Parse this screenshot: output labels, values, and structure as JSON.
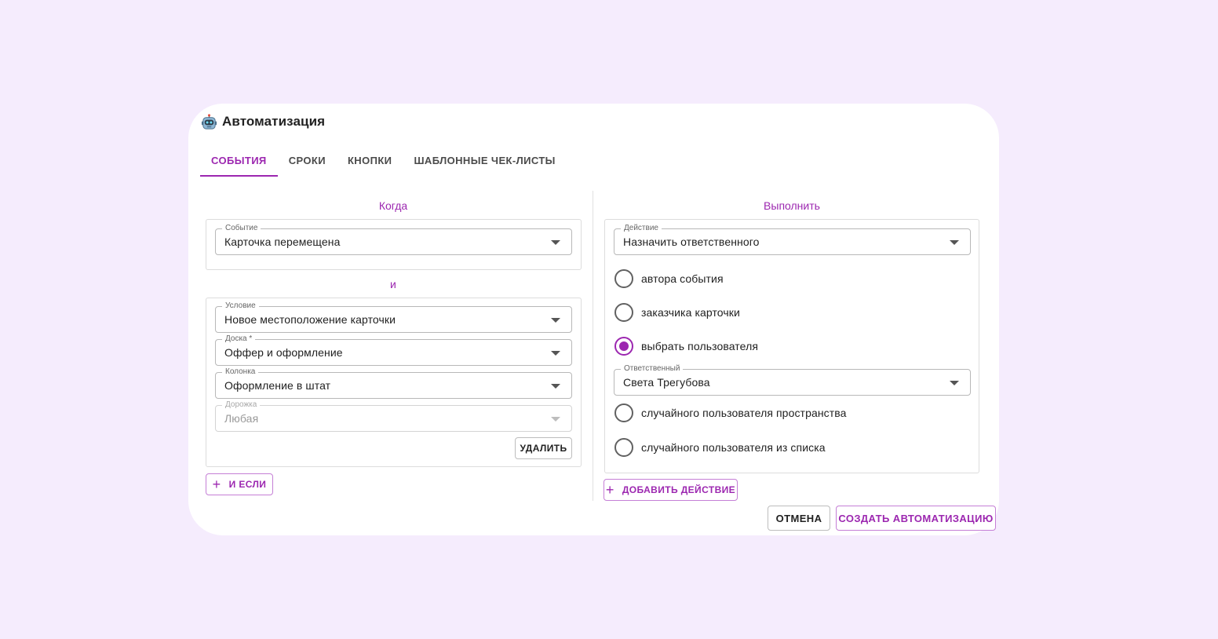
{
  "dialog": {
    "title": "Автоматизация",
    "title_icon": "robot-icon"
  },
  "tabs": [
    {
      "label": "СОБЫТИЯ",
      "active": true
    },
    {
      "label": "СРОКИ",
      "active": false
    },
    {
      "label": "КНОПКИ",
      "active": false
    },
    {
      "label": "ШАБЛОННЫЕ ЧЕК-ЛИСТЫ",
      "active": false
    }
  ],
  "when": {
    "title": "Когда",
    "event": {
      "legend": "Событие",
      "value": "Карточка перемещена"
    },
    "and_label": "и",
    "condition": {
      "legend": "Условие",
      "value": "Новое местоположение карточки"
    },
    "board": {
      "legend": "Доска *",
      "value": "Оффер и оформление"
    },
    "column": {
      "legend": "Колонка",
      "value": "Оформление в штат"
    },
    "lane": {
      "legend": "Дорожка",
      "value": "Любая",
      "disabled": true
    },
    "delete_label": "УДАЛИТЬ",
    "add_if_label": "И ЕСЛИ"
  },
  "execute": {
    "title": "Выполнить",
    "action": {
      "legend": "Действие",
      "value": "Назначить ответственного"
    },
    "options": [
      {
        "label": "автора события",
        "checked": false
      },
      {
        "label": "заказчика карточки",
        "checked": false
      },
      {
        "label": "выбрать пользователя",
        "checked": true
      },
      {
        "label": "случайного пользователя пространства",
        "checked": false
      },
      {
        "label": "случайного пользователя из списка",
        "checked": false
      }
    ],
    "assignee": {
      "legend": "Ответственный",
      "value": "Света Трегубова"
    },
    "add_action_label": "ДОБАВИТЬ ДЕЙСТВИЕ"
  },
  "footer": {
    "cancel_label": "ОТМЕНА",
    "create_label": "СОЗДАТЬ АВТОМАТИЗАЦИЮ"
  },
  "colors": {
    "accent": "#9c27b0",
    "background": "#f5ecfd"
  }
}
